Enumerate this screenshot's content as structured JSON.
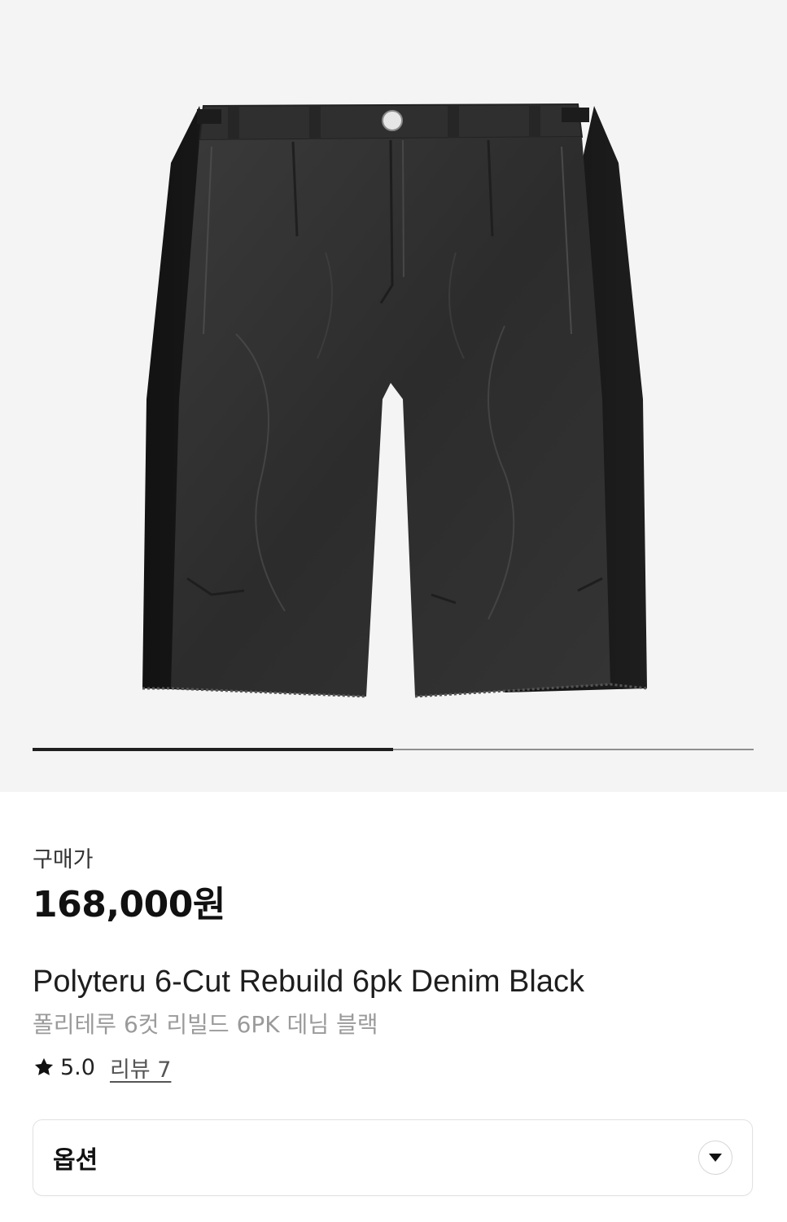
{
  "gallery": {
    "image_alt": "",
    "slide_progress": 0.5,
    "background_color": "#f4f4f5"
  },
  "price": {
    "label": "구매가",
    "value": "168,000원"
  },
  "product": {
    "name_en": "Polyteru 6-Cut Rebuild 6pk Denim Black",
    "name_ko": "폴리테루 6컷 리빌드 6PK 데님 블랙"
  },
  "rating": {
    "icon": "star-icon",
    "value": "5.0",
    "reviews_label": "리뷰 7"
  },
  "options": {
    "label": "옵션",
    "icon": "chevron-down-icon"
  }
}
